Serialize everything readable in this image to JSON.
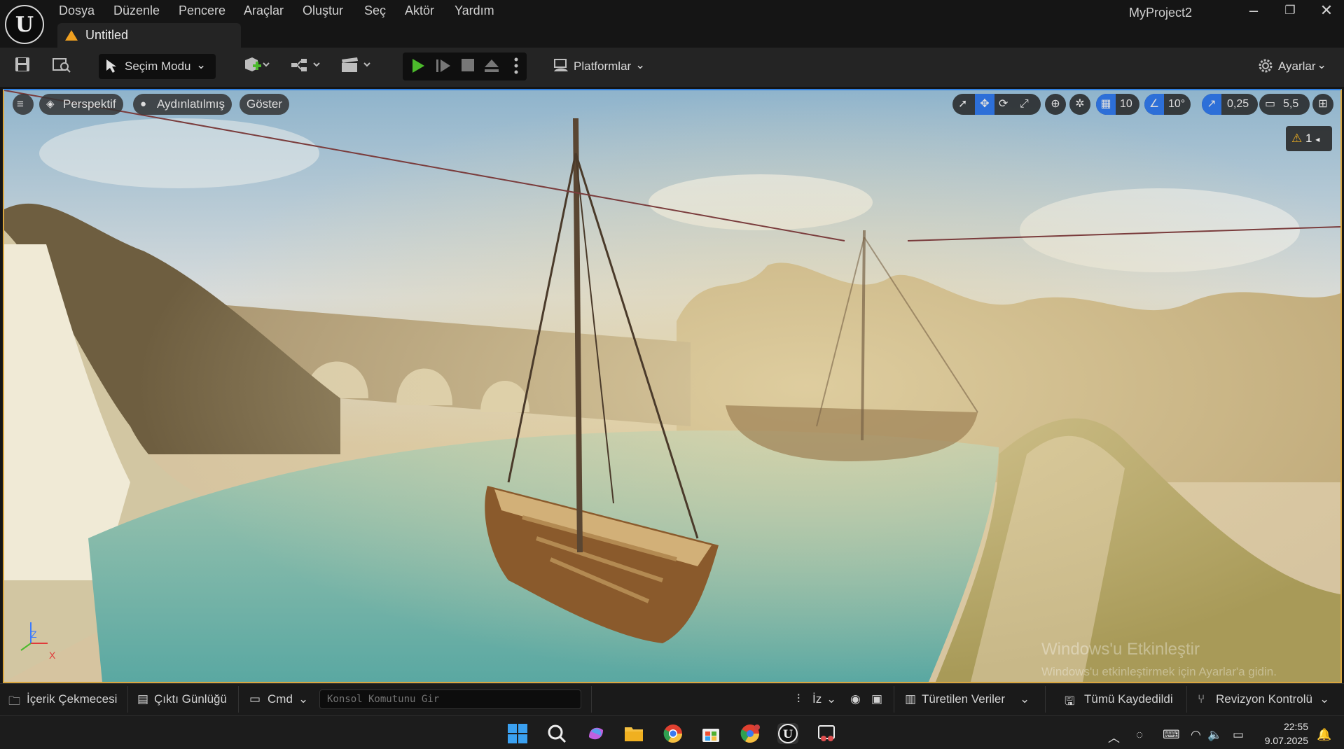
{
  "title_bar": {
    "menu": [
      "Dosya",
      "Düzenle",
      "Pencere",
      "Araçlar",
      "Oluştur",
      "Seç",
      "Aktör",
      "Yardım"
    ],
    "tab_label": "Untitled",
    "project_name": "MyProject2",
    "window_controls": [
      "minimize-icon",
      "restore-icon",
      "close-icon"
    ]
  },
  "toolbar": {
    "mode_label": "Seçim Modu",
    "platforms_label": "Platformlar",
    "settings_label": "Ayarlar"
  },
  "viewport": {
    "perspective_label": "Perspektif",
    "lighting_label": "Aydınlatılmış",
    "show_label": "Göster",
    "grid_snap": "10",
    "rotation_snap": "10°",
    "scale_snap": "0,25",
    "camera_speed": "5,5",
    "warning_count": "1",
    "axis_labels": [
      "Z",
      "X"
    ],
    "watermark_title": "Windows'u Etkinleştir",
    "watermark_sub": "Windows'u etkinleştirmek için Ayarlar'a gidin."
  },
  "status_bar": {
    "content_drawer": "İçerik Çekmecesi",
    "output_log": "Çıktı Günlüğü",
    "cmd_label": "Cmd",
    "console_placeholder": "Konsol Komutunu Gir",
    "trace_label": "İz",
    "derived_data": "Türetilen Veriler",
    "all_saved": "Tümü Kaydedildi",
    "revision_control": "Revizyon Kontrolü"
  },
  "taskbar": {
    "time": "22:55",
    "date": "9.07.2025"
  },
  "colors": {
    "accent_blue": "#2d6fd8",
    "play_green": "#4cba2c",
    "warning_orange": "#f0a020"
  }
}
